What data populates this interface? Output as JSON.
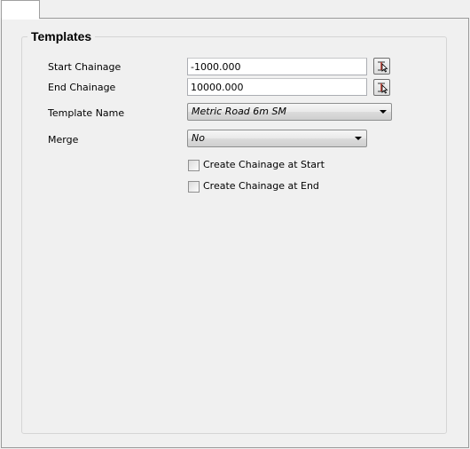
{
  "group": {
    "title": "Templates"
  },
  "fields": {
    "start_chainage": {
      "label": "Start Chainage",
      "value": "-1000.000",
      "pick_icon": "pick-from-view-icon"
    },
    "end_chainage": {
      "label": "End Chainage",
      "value": "10000.000",
      "pick_icon": "pick-from-view-icon"
    },
    "template_name": {
      "label": "Template Name",
      "value": "Metric Road 6m SM"
    },
    "merge": {
      "label": "Merge",
      "value": "No"
    }
  },
  "options": {
    "create_start": {
      "label": "Create Chainage at Start",
      "checked": false
    },
    "create_end": {
      "label": "Create Chainage at End",
      "checked": false
    }
  },
  "colors": {
    "background": "#f0f0f0",
    "border": "#9a9a9a",
    "pick_icon_accent": "#c0392b"
  }
}
